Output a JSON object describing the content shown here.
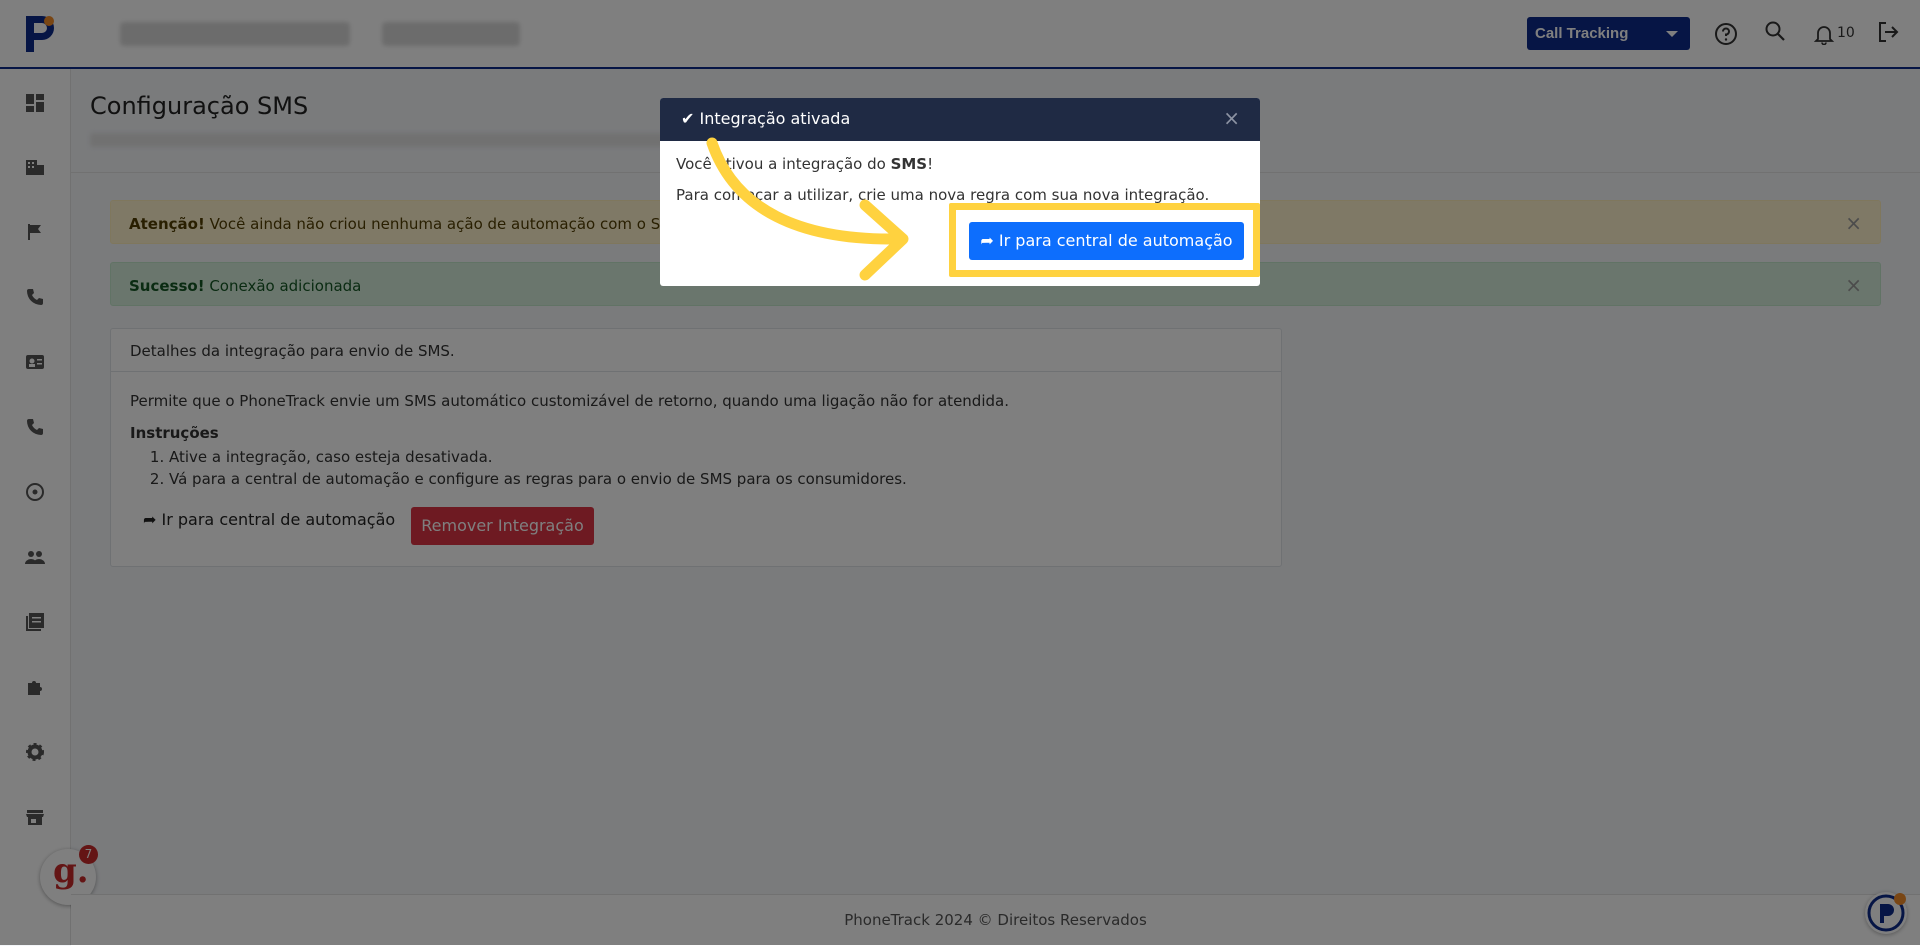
{
  "header": {
    "product_select": "Call Tracking",
    "notification_count": "10"
  },
  "page": {
    "title": "Configuração SMS"
  },
  "alerts": {
    "warning": {
      "strong": "Atenção!",
      "text": " Você ainda não criou nenhuma ação de automação com o SMS"
    },
    "success": {
      "strong": "Sucesso!",
      "text": " Conexão adicionada"
    }
  },
  "card": {
    "header": "Detalhes da integração para envio de SMS.",
    "description": "Permite que o PhoneTrack envie um SMS automático customizável de retorno, quando uma ligação não for atendida.",
    "instructions_title": "Instruções",
    "instructions": [
      "Ative a integração, caso esteja desativada.",
      "Vá para a central de automação e configure as regras para o envio de SMS para os consumidores."
    ],
    "link_button": "Ir para central de automação",
    "remove_button": "Remover Integração"
  },
  "footer": {
    "text": "PhoneTrack 2024 © Direitos Reservados"
  },
  "badge": {
    "letter": "g.",
    "count": "7"
  },
  "modal": {
    "title": "Integração ativada",
    "line1_pre": "Você ativou a integração do ",
    "line1_strong": "SMS",
    "line1_post": "!",
    "line2": "Para começar a utilizar, crie uma nova regra com sua nova integração.",
    "button": "Ir para central de automação"
  },
  "colors": {
    "brand_navy": "#0d2a8a",
    "primary": "#0d6efd",
    "danger": "#dc3545",
    "highlight": "#ffd23f"
  }
}
